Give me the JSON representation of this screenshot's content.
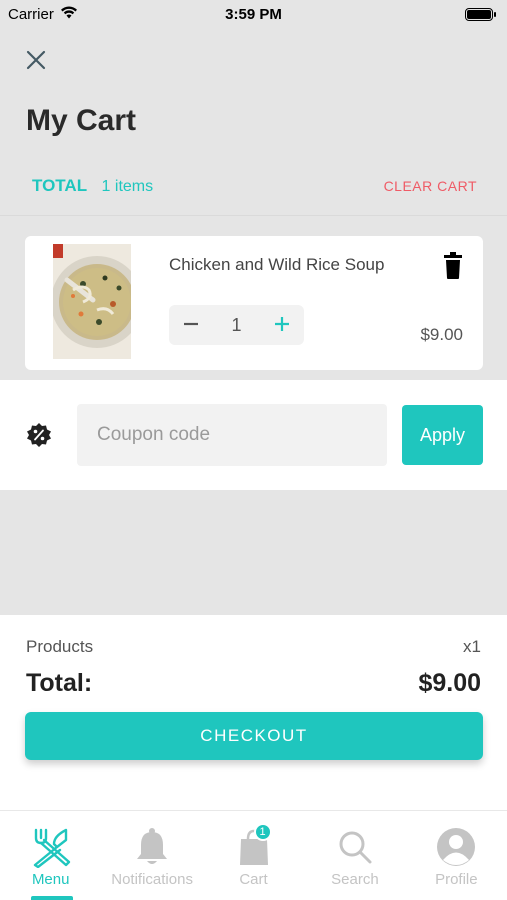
{
  "status_bar": {
    "carrier": "Carrier",
    "time": "3:59 PM"
  },
  "header": {
    "title": "My Cart"
  },
  "cart_summary": {
    "total_label": "TOTAL",
    "items_count": "1 items",
    "clear_label": "CLEAR CART"
  },
  "items": [
    {
      "name": "Chicken and Wild Rice Soup",
      "quantity": "1",
      "price": "$9.00"
    }
  ],
  "coupon": {
    "placeholder": "Coupon code",
    "apply_label": "Apply"
  },
  "summary": {
    "products_label": "Products",
    "products_value": "x1",
    "total_label": "Total:",
    "total_value": "$9.00",
    "checkout_label": "CHECKOUT"
  },
  "tabs": [
    {
      "label": "Menu",
      "icon": "fork-knife-icon",
      "active": true
    },
    {
      "label": "Notifications",
      "icon": "bell-icon"
    },
    {
      "label": "Cart",
      "icon": "bag-icon",
      "badge": "1"
    },
    {
      "label": "Search",
      "icon": "search-icon"
    },
    {
      "label": "Profile",
      "icon": "user-icon"
    }
  ],
  "colors": {
    "accent": "#1fc6be",
    "danger": "#ef5b66",
    "background": "#e5e5e5"
  }
}
